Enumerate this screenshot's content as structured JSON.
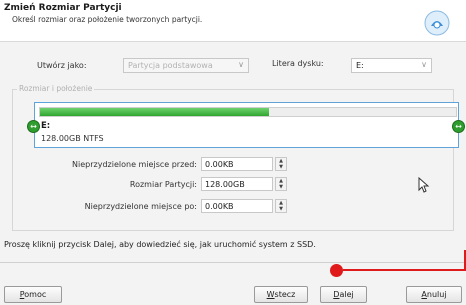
{
  "header": {
    "title": "Zmień Rozmiar Partycji",
    "subtitle": "Określ rozmiar oraz położenie tworzonych partycji."
  },
  "create_as": {
    "label": "Utwórz jako:",
    "value": "Partycja podstawowa"
  },
  "drive_letter": {
    "label": "Litera dysku:",
    "value": "E:"
  },
  "group": {
    "title": "Rozmiar i położenie"
  },
  "disk": {
    "letter": "E:",
    "size": "128.00GB NTFS",
    "fill_fraction": 0.55,
    "fill_color": "#2fa52f"
  },
  "fields": {
    "before": {
      "label": "Nieprzydzielone miejsce przed:",
      "value": "0.00KB"
    },
    "size": {
      "label": "Rozmiar Partycji:",
      "value": "128.00GB"
    },
    "after": {
      "label": "Nieprzydzielone miejsce po:",
      "value": "0.00KB"
    }
  },
  "info_text": "Proszę kliknij przycisk Dalej, aby dowiedzieć się, jak uruchomić system z SSD.",
  "buttons": {
    "help_first": "P",
    "help_rest": "omoc",
    "back_first": "W",
    "back_rest": "stecz",
    "next_first": "D",
    "next_rest": "alej",
    "cancel_first": "A",
    "cancel_rest": "nuluj"
  },
  "accent_color": "#e0191b"
}
